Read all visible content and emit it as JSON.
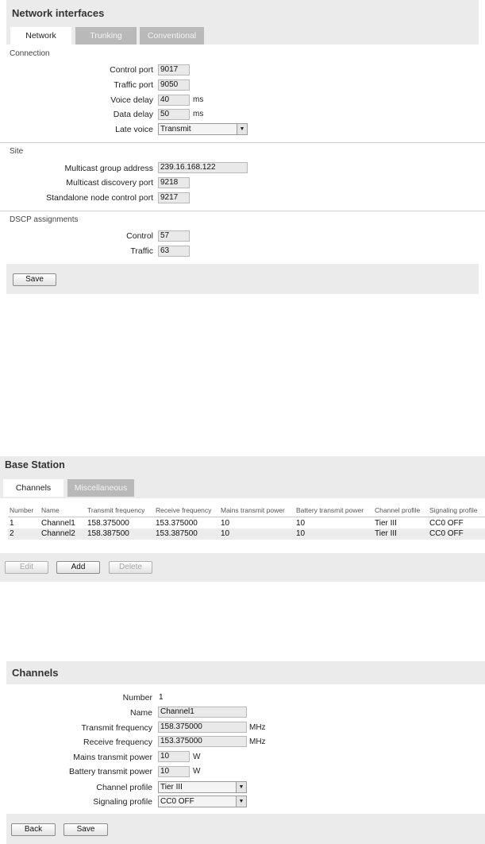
{
  "network": {
    "title": "Network interfaces",
    "tabs": [
      {
        "label": "Network",
        "active": true
      },
      {
        "label": "Trunking",
        "active": false
      },
      {
        "label": "Conventional",
        "active": false
      }
    ],
    "connection": {
      "heading": "Connection",
      "control_port": {
        "label": "Control port",
        "value": "9017"
      },
      "traffic_port": {
        "label": "Traffic port",
        "value": "9050"
      },
      "voice_delay": {
        "label": "Voice delay",
        "value": "40",
        "unit": "ms"
      },
      "data_delay": {
        "label": "Data delay",
        "value": "50",
        "unit": "ms"
      },
      "late_voice": {
        "label": "Late voice",
        "value": "Transmit"
      }
    },
    "site": {
      "heading": "Site",
      "multicast_group_address": {
        "label": "Multicast group address",
        "value": "239.16.168.122"
      },
      "multicast_discovery_port": {
        "label": "Multicast discovery port",
        "value": "9218"
      },
      "standalone_node_control_port": {
        "label": "Standalone node control port",
        "value": "9217"
      }
    },
    "dscp": {
      "heading": "DSCP assignments",
      "control": {
        "label": "Control",
        "value": "57"
      },
      "traffic": {
        "label": "Traffic",
        "value": "63"
      }
    },
    "save_label": "Save"
  },
  "base_station": {
    "title": "Base Station",
    "tabs": [
      {
        "label": "Channels",
        "active": true
      },
      {
        "label": "Miscellaneous",
        "active": false
      }
    ],
    "columns": [
      "Number",
      "Name",
      "Transmit frequency",
      "Receive frequency",
      "Mains transmit power",
      "Battery transmit power",
      "Channel profile",
      "Signaling profile"
    ],
    "rows": [
      [
        "1",
        "Channel1",
        "158.375000",
        "153.375000",
        "10",
        "10",
        "Tier III",
        "CC0 OFF"
      ],
      [
        "2",
        "Channel2",
        "158.387500",
        "153.387500",
        "10",
        "10",
        "Tier III",
        "CC0 OFF"
      ]
    ],
    "buttons": {
      "edit": "Edit",
      "add": "Add",
      "delete": "Delete"
    }
  },
  "channels": {
    "title": "Channels",
    "number": {
      "label": "Number",
      "value": "1"
    },
    "name": {
      "label": "Name",
      "value": "Channel1"
    },
    "transmit_frequency": {
      "label": "Transmit frequency",
      "value": "158.375000",
      "unit": "MHz"
    },
    "receive_frequency": {
      "label": "Receive frequency",
      "value": "153.375000",
      "unit": "MHz"
    },
    "mains_transmit_power": {
      "label": "Mains transmit power",
      "value": "10",
      "unit": "W"
    },
    "battery_transmit_power": {
      "label": "Battery transmit power",
      "value": "10",
      "unit": "W"
    },
    "channel_profile": {
      "label": "Channel profile",
      "value": "Tier III"
    },
    "signaling_profile": {
      "label": "Signaling profile",
      "value": "CC0 OFF"
    },
    "buttons": {
      "back": "Back",
      "save": "Save"
    }
  }
}
